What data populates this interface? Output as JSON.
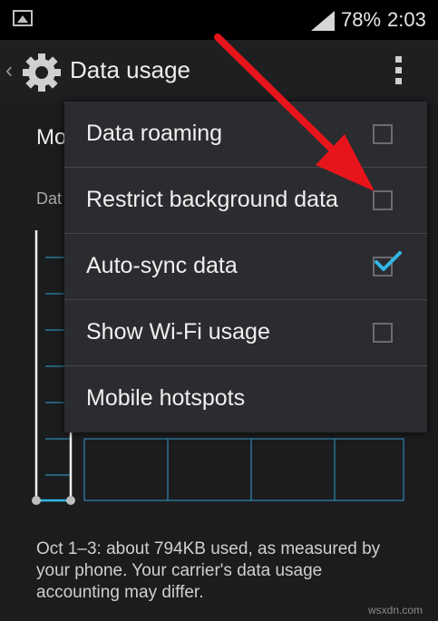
{
  "status_bar": {
    "battery": "78%",
    "time": "2:03"
  },
  "action_bar": {
    "title": "Data usage"
  },
  "background": {
    "title_fragment": "Mo",
    "subtitle_fragment": "Dat",
    "footnote": "Oct 1–3: about 794KB used, as measured by your phone. Your carrier's data usage accounting may differ."
  },
  "menu": {
    "items": [
      {
        "label": "Data roaming",
        "has_checkbox": true,
        "checked": false
      },
      {
        "label": "Restrict background data",
        "has_checkbox": true,
        "checked": false
      },
      {
        "label": "Auto-sync data",
        "has_checkbox": true,
        "checked": true
      },
      {
        "label": "Show Wi-Fi usage",
        "has_checkbox": true,
        "checked": false
      },
      {
        "label": "Mobile hotspots",
        "has_checkbox": false,
        "checked": false
      }
    ]
  },
  "colors": {
    "accent": "#33b5e5",
    "annotation_arrow": "#e8141b",
    "menu_bg": "#2b2c2f",
    "action_bar_bg": "#1e1f21"
  },
  "watermark": "wsxdn.com"
}
